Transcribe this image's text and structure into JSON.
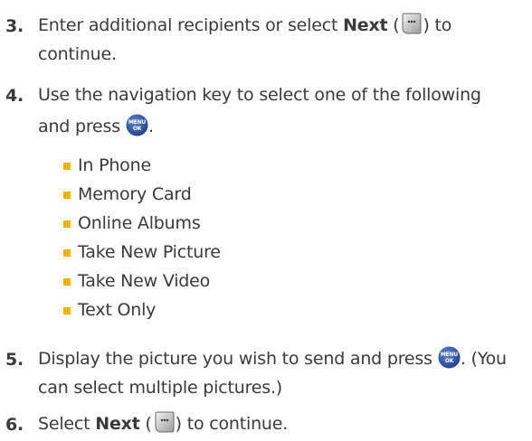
{
  "steps": [
    {
      "number": "3.",
      "line1_before": "Enter additional recipients or select ",
      "line1_bold": "Next",
      "line1_mid": " (",
      "line1_after": ") to",
      "line2": "continue."
    },
    {
      "number": "4.",
      "line1": "Use the navigation key to select one of the following",
      "line2_before": "and press",
      "line2_after": "."
    },
    {
      "number": "5.",
      "line1_before": "Display the picture you wish to send and press",
      "line1_after": ". (You",
      "line2": "can select multiple pictures.)"
    },
    {
      "number": "6.",
      "line1_before": "Select ",
      "line1_bold": "Next",
      "line1_mid": " (",
      "line1_after": ") to continue."
    }
  ],
  "options": [
    "In Phone",
    "Memory Card",
    "Online Albums",
    "Take New Picture",
    "Take New Video",
    "Text Only"
  ],
  "icons": {
    "softkey": "right-softkey-icon",
    "menu_ok": "menu-ok-key-icon",
    "menu_ok_top": "MENU",
    "menu_ok_bottom": "OK"
  },
  "colors": {
    "bullet": "#f2b705",
    "key_blue": "#2f5aa8",
    "text": "#3a3a3a"
  }
}
